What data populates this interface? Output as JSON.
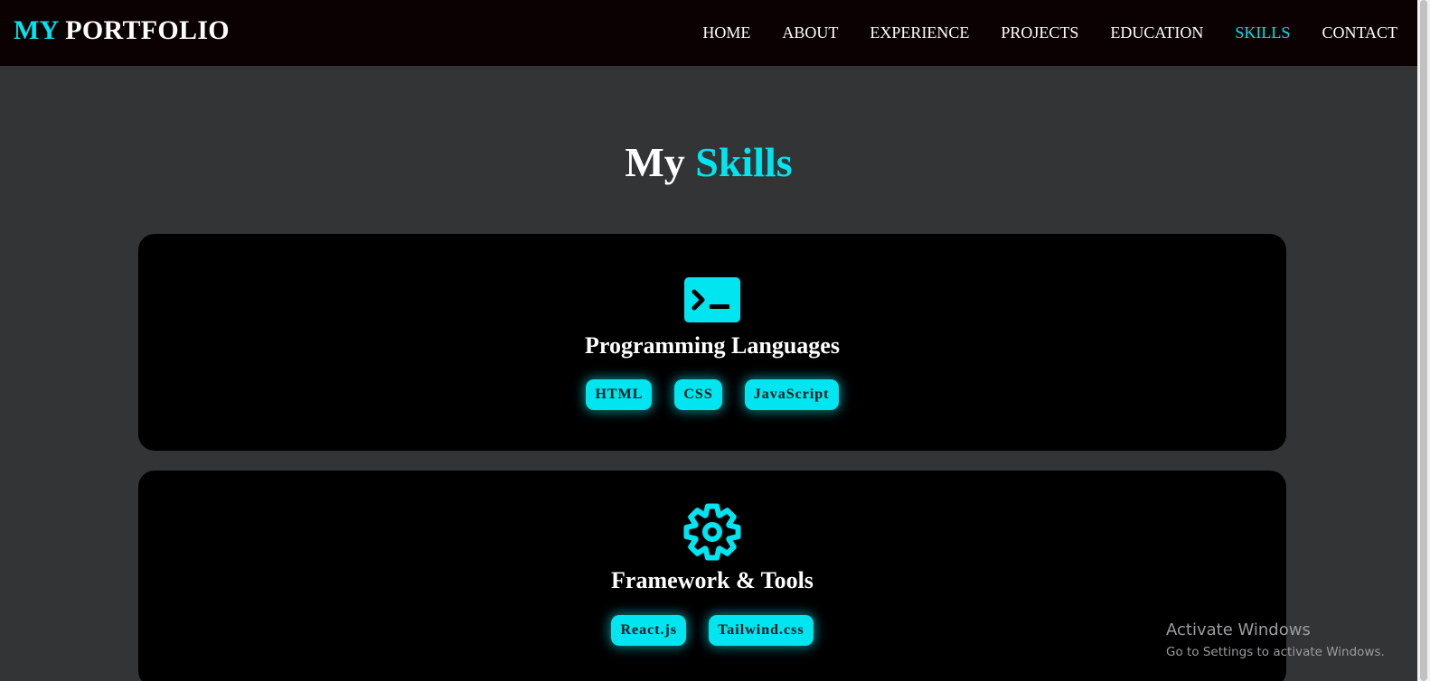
{
  "nav": {
    "logo_accent": "MY",
    "logo_rest": " PORTFOLIO",
    "links": [
      "HOME",
      "ABOUT",
      "EXPERIENCE",
      "PROJECTS",
      "EDUCATION",
      "SKILLS",
      "CONTACT"
    ],
    "active_link": "SKILLS"
  },
  "section": {
    "title_prefix": "My ",
    "title_accent": "Skills"
  },
  "cards": [
    {
      "icon": "terminal-icon",
      "title": "Programming Languages",
      "tags": [
        "HTML",
        "CSS",
        "JavaScript"
      ]
    },
    {
      "icon": "gear-icon",
      "title": "Framework & Tools",
      "tags": [
        "React.js",
        "Tailwind.css"
      ]
    }
  ],
  "watermark": {
    "title": "Activate Windows",
    "subtitle": "Go to Settings to activate Windows."
  },
  "colors": {
    "accent": "#00e5ef",
    "background": "#333436",
    "navbar": "#0b0103",
    "card": "#000000"
  }
}
